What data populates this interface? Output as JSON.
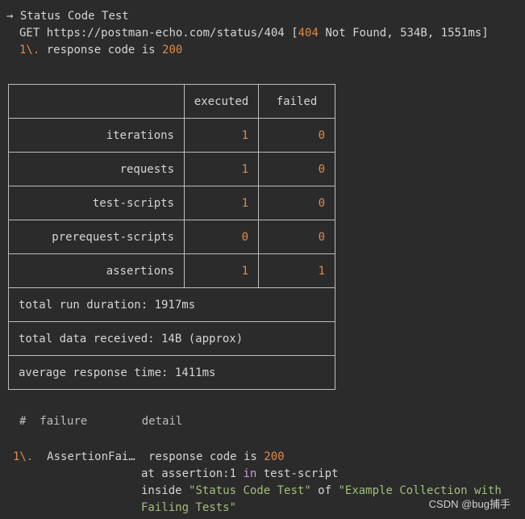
{
  "header": {
    "arrow": "→",
    "title": "Status Code Test",
    "request_method": "GET",
    "request_url": "https://postman-echo.com/status/404",
    "status_open": "[",
    "status_code": "404",
    "status_text": "Not Found, 534B, 1551ms]",
    "assertion_index": "1\\.",
    "assertion_text": "response code is",
    "assertion_value": "200"
  },
  "summary_table": {
    "columns": [
      "",
      "executed",
      "failed"
    ],
    "rows": [
      {
        "label": "iterations",
        "executed": "1",
        "failed": "0"
      },
      {
        "label": "requests",
        "executed": "1",
        "failed": "0"
      },
      {
        "label": "test-scripts",
        "executed": "1",
        "failed": "0"
      },
      {
        "label": "prerequest-scripts",
        "executed": "0",
        "failed": "0"
      },
      {
        "label": "assertions",
        "executed": "1",
        "failed": "1"
      }
    ],
    "footer": [
      "total run duration: 1917ms",
      "total data received: 14B (approx)",
      "average response time: 1411ms"
    ]
  },
  "failures": {
    "columns": [
      "#",
      "failure",
      "detail"
    ],
    "index": "1\\.",
    "failure": "AssertionFai…",
    "detail_line1_text": "response code is",
    "detail_line1_value": "200",
    "detail_line2_pre": "at assertion:1",
    "detail_line2_kw": "in",
    "detail_line2_post": "test-script",
    "detail_line3_pre": "inside",
    "detail_line3_q1": "\"Status Code Test\"",
    "detail_line3_mid": "of",
    "detail_line3_q2": "\"Example Collection with",
    "detail_line4": "Failing Tests\""
  },
  "watermark": "CSDN @bug捕手"
}
